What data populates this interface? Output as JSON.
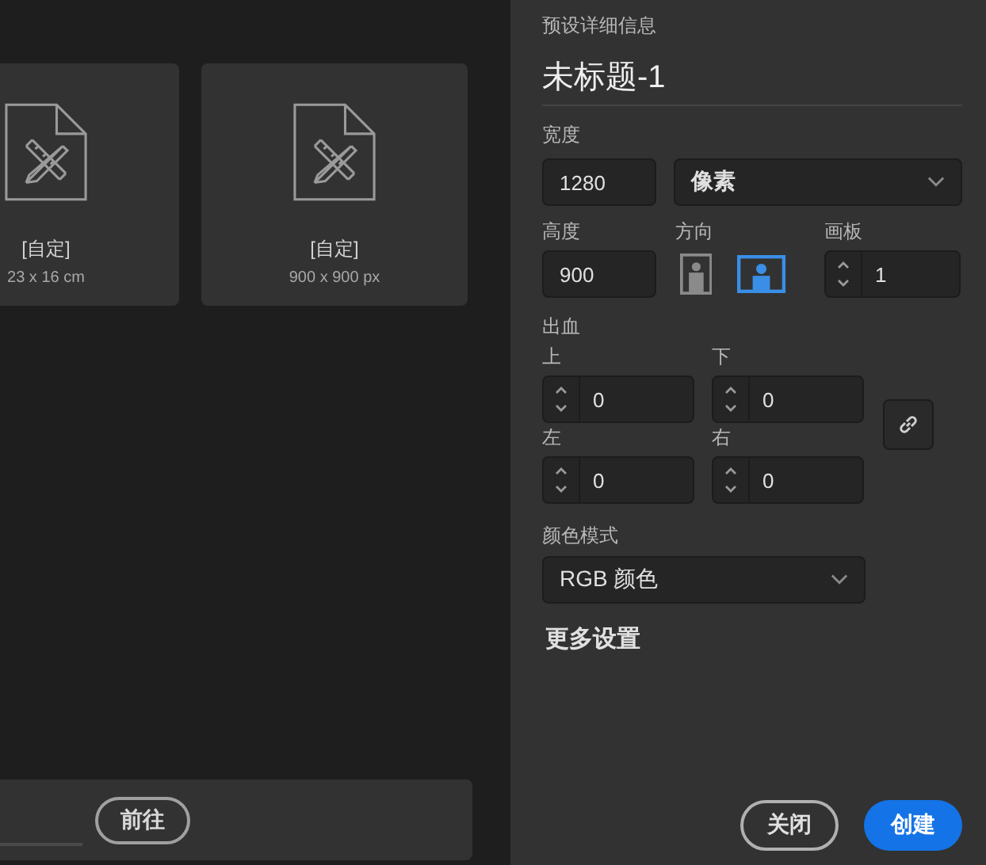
{
  "presets": [
    {
      "name": "[自定]",
      "size": "23 x 16 cm"
    },
    {
      "name": "[自定]",
      "size": "900 x 900 px"
    }
  ],
  "bottom_bar": {
    "button": "前往"
  },
  "details": {
    "heading": "预设详细信息",
    "title": "未标题-1",
    "width": {
      "label": "宽度",
      "value": "1280"
    },
    "unit": {
      "value": "像素"
    },
    "height": {
      "label": "高度",
      "value": "900"
    },
    "orientation": {
      "label": "方向",
      "options": [
        {
          "kind": "portrait",
          "selected": false
        },
        {
          "kind": "landscape",
          "selected": true
        }
      ]
    },
    "artboards": {
      "label": "画板",
      "value": "1"
    },
    "bleed": {
      "label": "出血",
      "fields": [
        {
          "label": "上",
          "value": "0"
        },
        {
          "label": "下",
          "value": "0"
        },
        {
          "label": "左",
          "value": "0"
        },
        {
          "label": "右",
          "value": "0"
        }
      ]
    },
    "color_mode": {
      "label": "颜色模式",
      "value": "RGB 颜色"
    },
    "more_settings": "更多设置"
  },
  "buttons": [
    {
      "label": "关闭",
      "kind": "secondary"
    },
    {
      "label": "创建",
      "kind": "primary"
    }
  ]
}
